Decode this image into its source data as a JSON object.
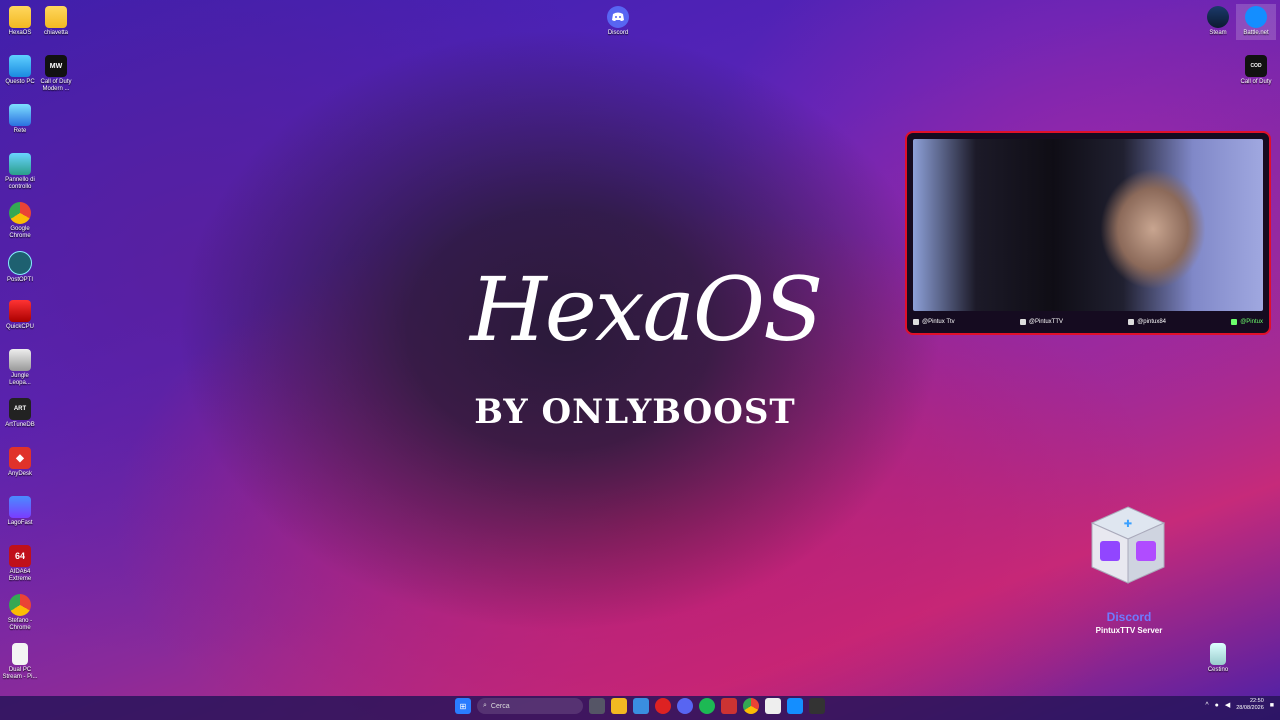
{
  "desktop_left": [
    {
      "label": "HexaOS",
      "icon": "folder-icon"
    },
    {
      "label": "chiavetta",
      "icon": "folder-icon"
    },
    {
      "label": "Questo PC",
      "icon": "monitor-icon"
    },
    {
      "label": "Call of Duty Modern ...",
      "icon": "mwii-icon"
    },
    {
      "label": "Rete",
      "icon": "network-icon"
    },
    {
      "label": "Pannello di controllo",
      "icon": "control-panel-icon"
    },
    {
      "label": "Google Chrome",
      "icon": "chrome-icon"
    },
    {
      "label": "PostOPTI",
      "icon": "postopti-icon"
    },
    {
      "label": "QuickCPU",
      "icon": "quickcpu-icon"
    },
    {
      "label": "Jungle Leopa...",
      "icon": "jungle-leopard-icon"
    },
    {
      "label": "ArtTuneDB",
      "icon": "arttunedb-icon"
    },
    {
      "label": "AnyDesk",
      "icon": "anydesk-icon"
    },
    {
      "label": "LagoFast",
      "icon": "lagofast-icon"
    },
    {
      "label": "AIDA64 Extreme",
      "icon": "aida64-icon"
    },
    {
      "label": "Stefano - Chrome",
      "icon": "chrome-profile-icon"
    },
    {
      "label": "Dual PC Stream - Pi...",
      "icon": "document-icon"
    }
  ],
  "desktop_top": {
    "discord": "Discord"
  },
  "desktop_right": [
    {
      "label": "Steam",
      "icon": "steam-icon"
    },
    {
      "label": "Battle.net",
      "icon": "battlenet-icon"
    },
    {
      "label": "Call of Duty",
      "icon": "cod-icon"
    },
    {
      "label": "Cestino",
      "icon": "recycle-bin-icon"
    }
  ],
  "wallpaper": {
    "title": "HexaOS",
    "subtitle": "BY ONLYBOOST"
  },
  "cam_overlay": {
    "socials": [
      "@Pintux Ttv",
      "@PintuxTTV",
      "@pintux84",
      "@Pintux"
    ]
  },
  "promo": {
    "title": "Discord",
    "subtitle": "PintuxTTV Server"
  },
  "taskbar": {
    "search_placeholder": "Cerca",
    "time": "22:50",
    "date": "28/08/2026"
  },
  "colors": {
    "accent": "#e0102a",
    "discord": "#6e7bff",
    "taskbar": "#28145a"
  }
}
